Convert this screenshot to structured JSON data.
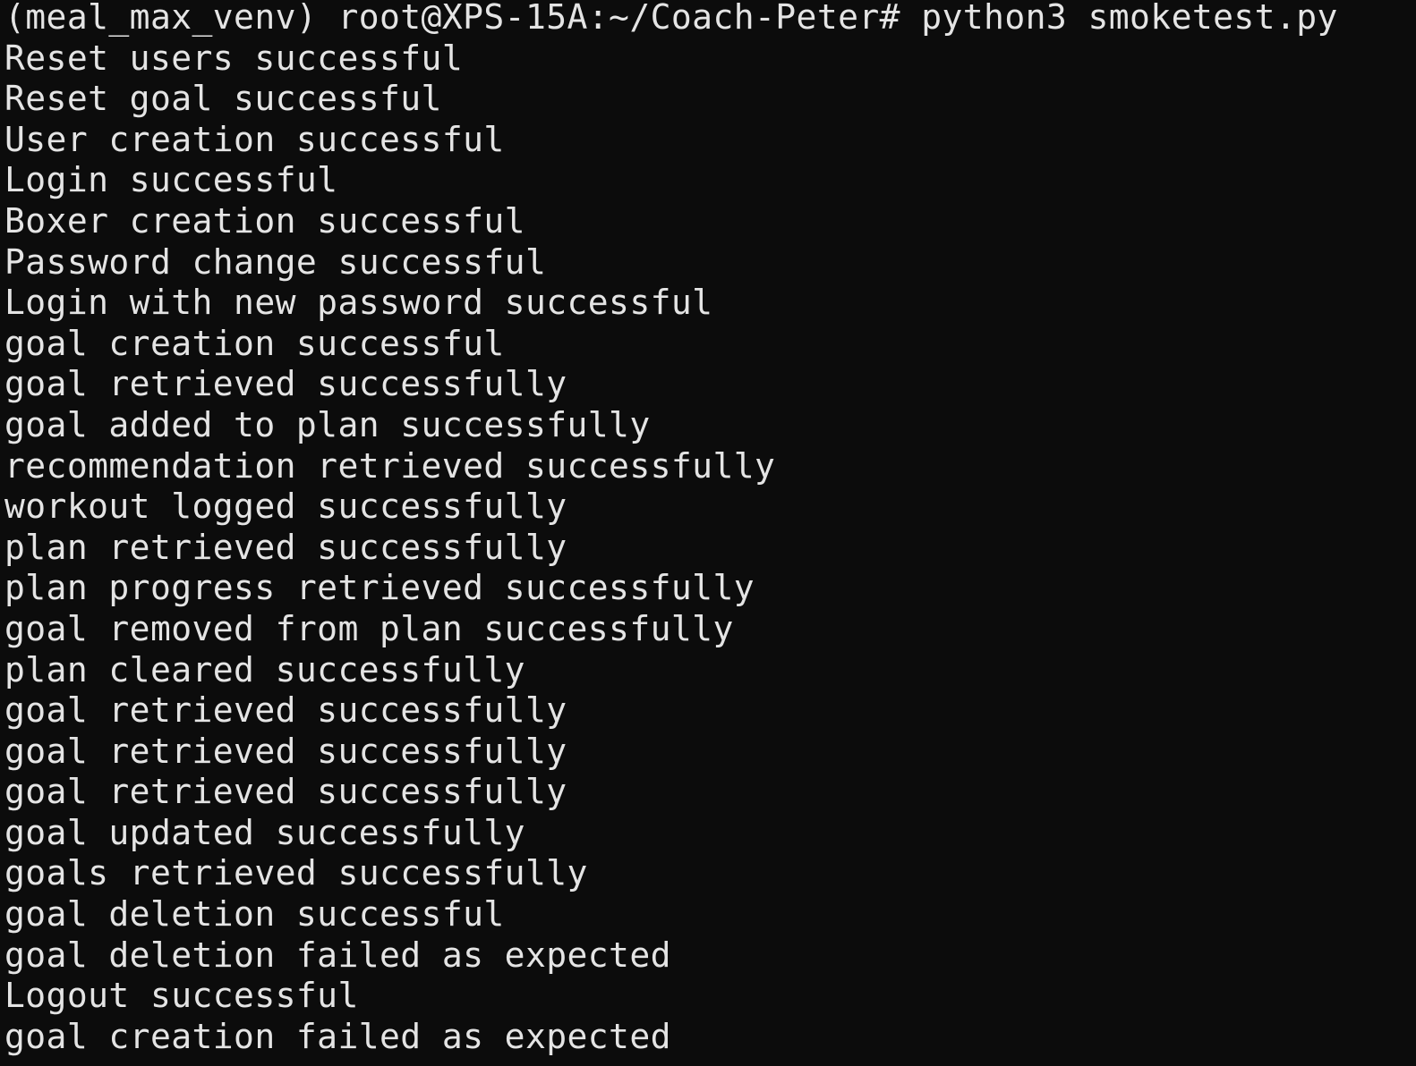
{
  "terminal": {
    "prompt": "(meal_max_venv) root@XPS-15A:~/Coach-Peter# python3 smoketest.py",
    "output": [
      "Reset users successful",
      "Reset goal successful",
      "User creation successful",
      "Login successful",
      "Boxer creation successful",
      "Password change successful",
      "Login with new password successful",
      "goal creation successful",
      "goal retrieved successfully",
      "goal added to plan successfully",
      "recommendation retrieved successfully",
      "workout logged successfully",
      "plan retrieved successfully",
      "plan progress retrieved successfully",
      "goal removed from plan successfully",
      "plan cleared successfully",
      "goal retrieved successfully",
      "goal retrieved successfully",
      "goal retrieved successfully",
      "goal updated successfully",
      "goals retrieved successfully",
      "goal deletion successful",
      "goal deletion failed as expected",
      "Logout successful",
      "goal creation failed as expected"
    ],
    "colors": {
      "background": "#0c0c0c",
      "text": "#e4e4e4"
    }
  }
}
